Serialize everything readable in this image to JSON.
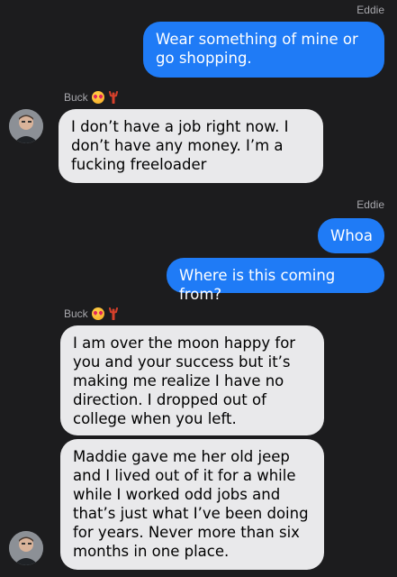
{
  "conversation": {
    "messages": [
      {
        "sender": "Eddie",
        "direction": "out",
        "text": "Wear something of mine or go shopping."
      },
      {
        "sender": "Buck",
        "direction": "in",
        "text": "I don’t have a job right now. I don’t have any money. I’m a fucking freeloader"
      },
      {
        "sender": "Eddie",
        "direction": "out",
        "text": "Whoa"
      },
      {
        "sender": "Eddie",
        "direction": "out",
        "text": "Where is this coming from?"
      },
      {
        "sender": "Buck",
        "direction": "in",
        "text": "I am over the moon happy for you and your success but it’s making me realize I have no direction. I dropped out of college when you left."
      },
      {
        "sender": "Buck",
        "direction": "in",
        "text": "Maddie gave me her old jeep and I lived out of it for a while while I worked odd jobs and that’s just what I’ve been doing for years. Never more than six months in one place."
      }
    ],
    "labels": {
      "eddie_1": "Eddie",
      "buck_1": "Buck",
      "eddie_2": "Eddie",
      "buck_2": "Buck"
    },
    "icons": {
      "sender_emoji_1": "heart-eyes-emoji-icon",
      "sender_emoji_2": "lobster-emoji-icon",
      "avatar": "contact-avatar-icon"
    },
    "colors": {
      "background": "#1c1c1e",
      "outgoing_bubble": "#1f7bf6",
      "incoming_bubble": "#e9e9eb",
      "label": "#a8a8ad"
    }
  }
}
